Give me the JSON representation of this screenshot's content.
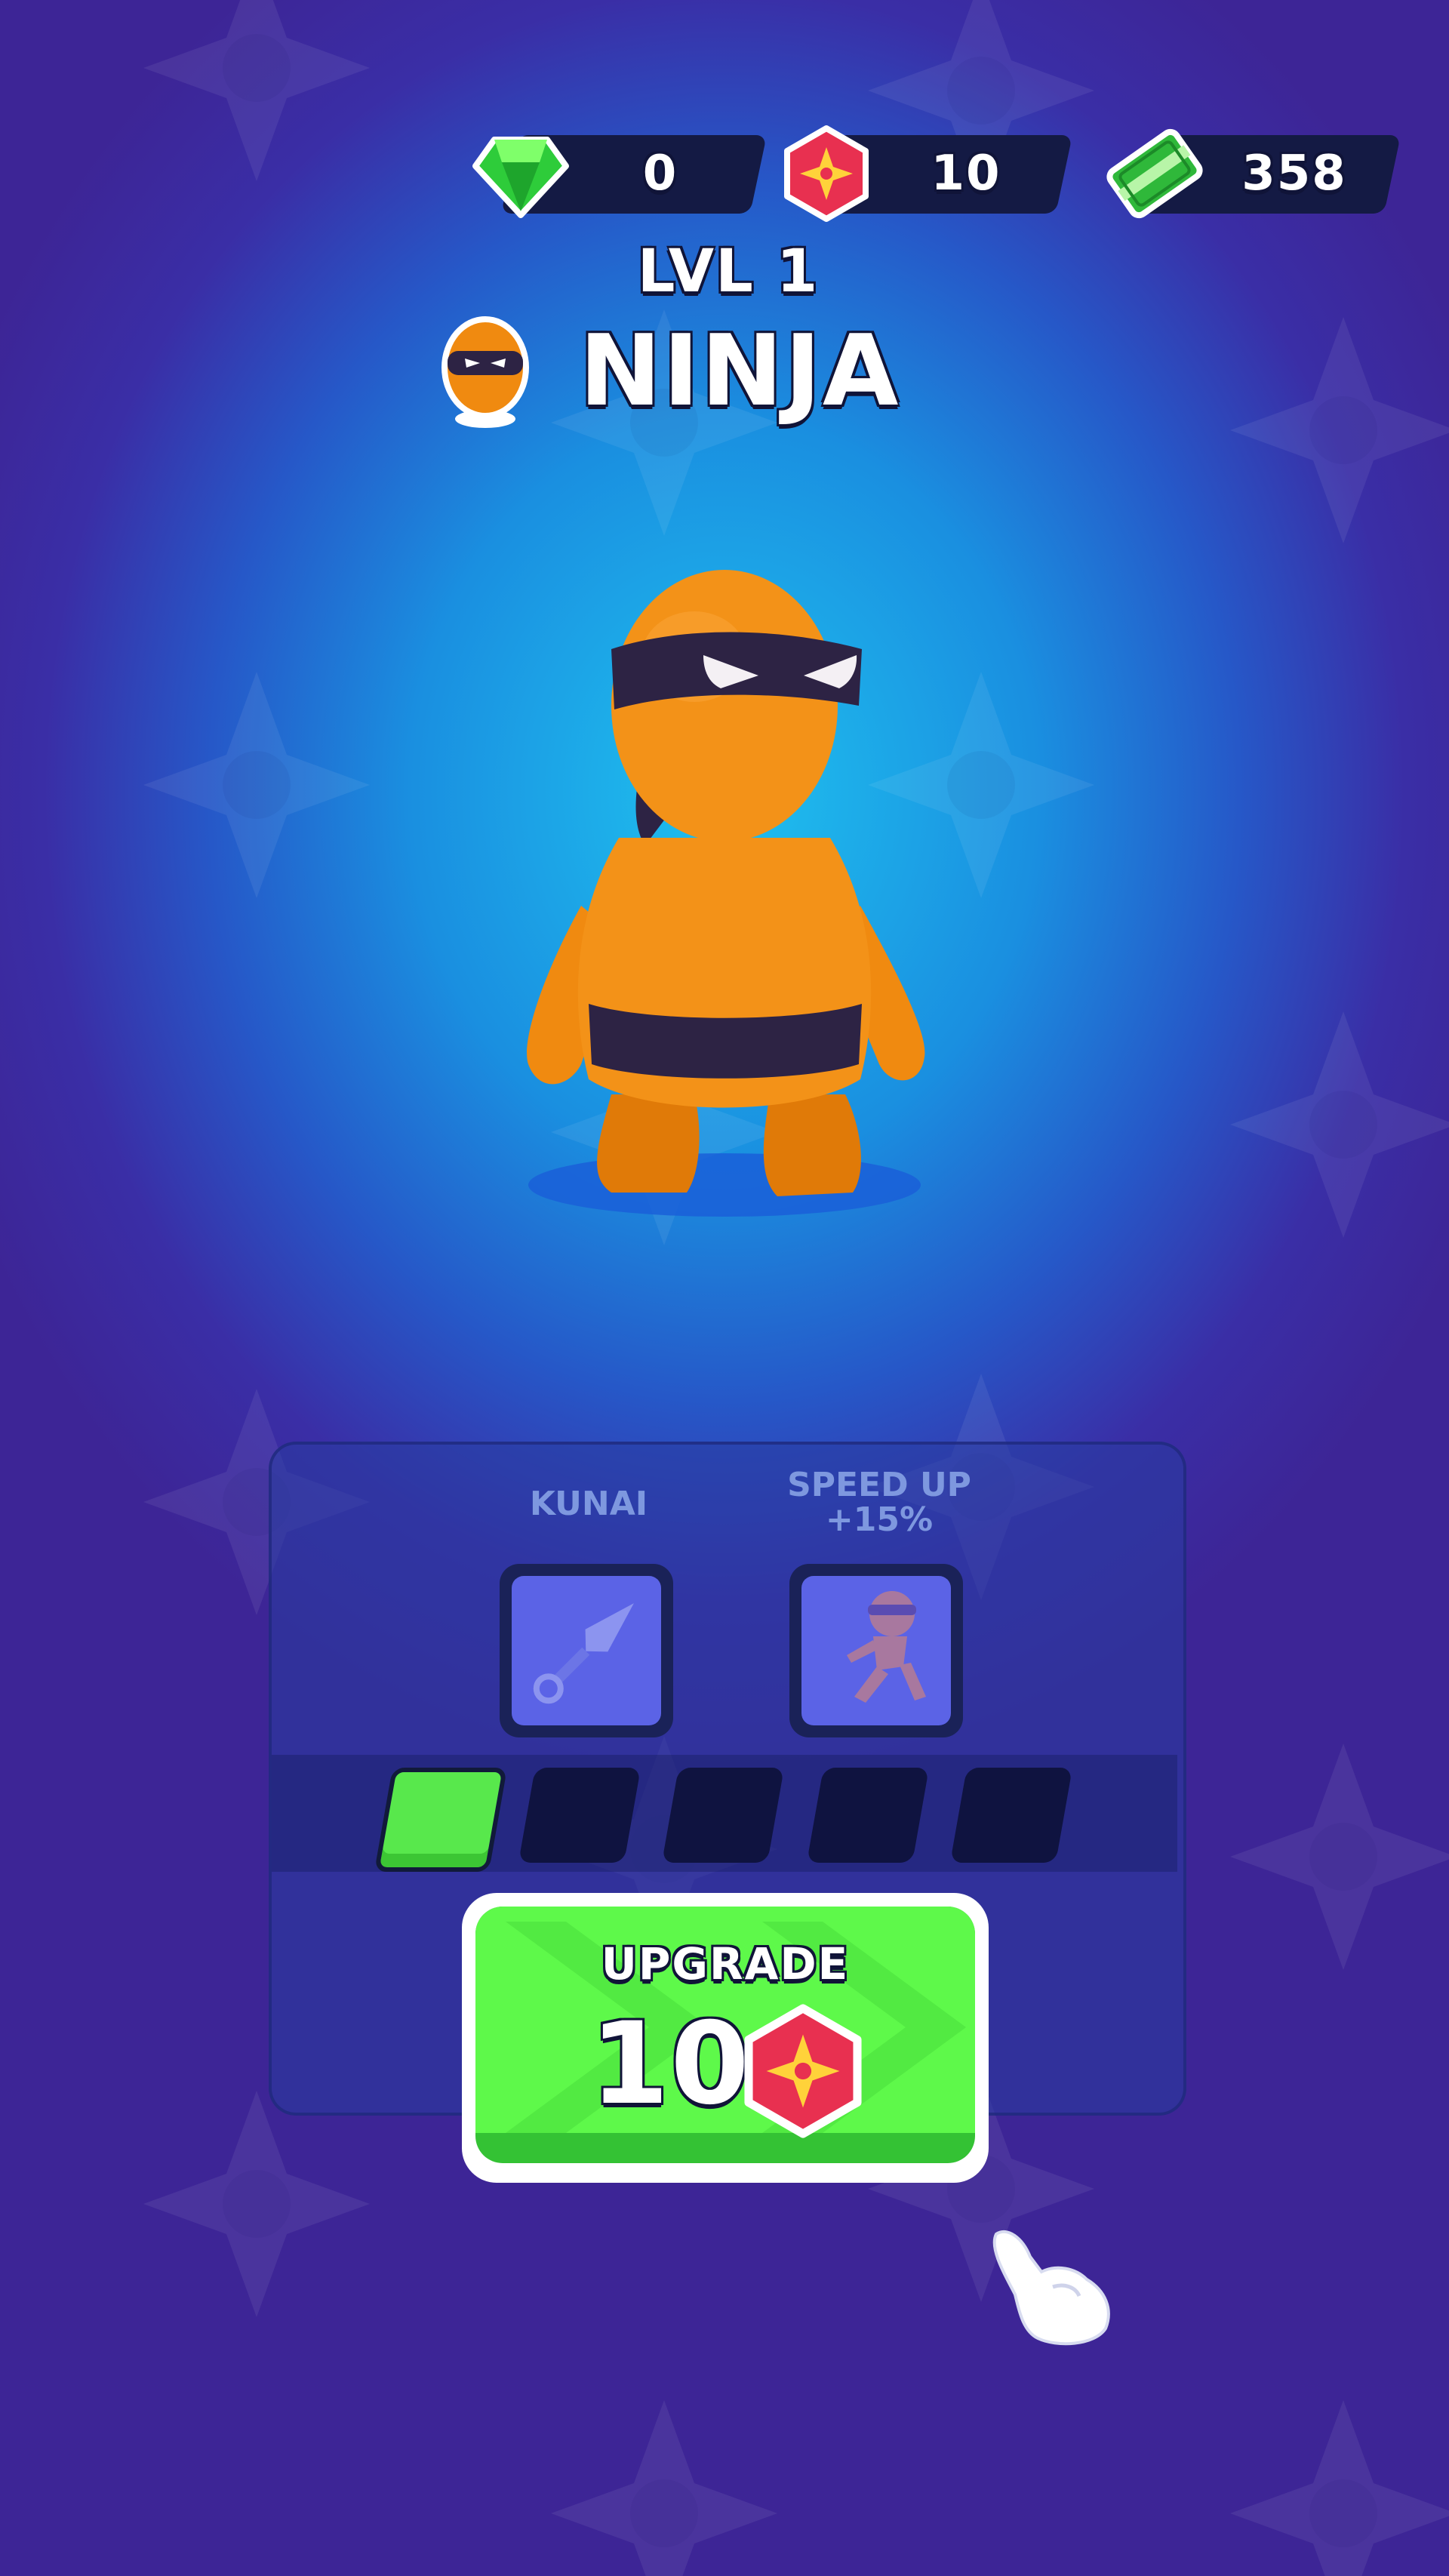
{
  "currencies": [
    {
      "name": "gems",
      "icon": "green-gem-icon",
      "value": "0"
    },
    {
      "name": "shuriken-tokens",
      "icon": "red-shuriken-badge-icon",
      "value": "10"
    },
    {
      "name": "cash",
      "icon": "cash-stack-icon",
      "value": "358"
    }
  ],
  "character": {
    "level": "LVL 1",
    "name": "NINJA",
    "avatar_icon": "ninja-head-icon",
    "body_color": "#f08a10",
    "mask_color": "#2d2344"
  },
  "upgrades": [
    {
      "label": "KUNAI",
      "icon": "kunai-icon"
    },
    {
      "label_line1": "SPEED UP",
      "label_line2": "+15%",
      "icon": "running-ninja-icon"
    }
  ],
  "progress": {
    "filled": 1,
    "total": 5,
    "fill_color": "#58e84c"
  },
  "upgrade_button": {
    "label": "UPGRADE",
    "cost": "10",
    "cost_icon": "red-shuriken-badge-icon",
    "color": "#5ef94a"
  },
  "hint": {
    "icon": "pointing-hand-icon"
  }
}
